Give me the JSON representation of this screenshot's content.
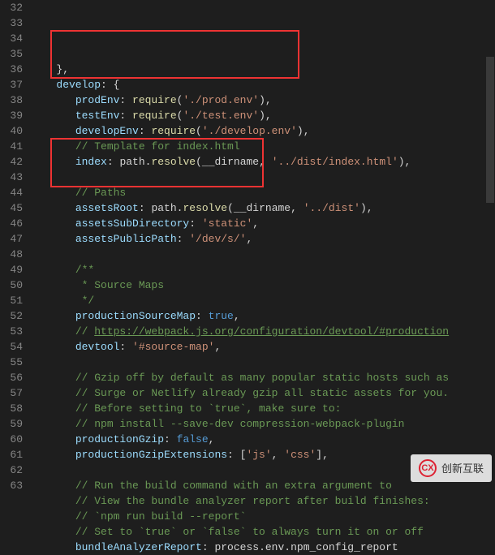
{
  "line_start": 32,
  "lines": [
    {
      "indent": 1,
      "tokens": [
        [
          "punc",
          "},"
        ]
      ]
    },
    {
      "indent": 1,
      "tokens": [
        [
          "prop",
          "develop"
        ],
        [
          "punc",
          ": {"
        ]
      ]
    },
    {
      "indent": 2,
      "tokens": [
        [
          "prop",
          "prodEnv"
        ],
        [
          "punc",
          ": "
        ],
        [
          "func",
          "require"
        ],
        [
          "punc",
          "("
        ],
        [
          "str",
          "'./prod.env'"
        ],
        [
          "punc",
          "),"
        ]
      ]
    },
    {
      "indent": 2,
      "tokens": [
        [
          "prop",
          "testEnv"
        ],
        [
          "punc",
          ": "
        ],
        [
          "func",
          "require"
        ],
        [
          "punc",
          "("
        ],
        [
          "str",
          "'./test.env'"
        ],
        [
          "punc",
          "),"
        ]
      ]
    },
    {
      "indent": 2,
      "tokens": [
        [
          "prop",
          "developEnv"
        ],
        [
          "punc",
          ": "
        ],
        [
          "func",
          "require"
        ],
        [
          "punc",
          "("
        ],
        [
          "str",
          "'./develop.env'"
        ],
        [
          "punc",
          "),"
        ]
      ]
    },
    {
      "indent": 2,
      "tokens": [
        [
          "com",
          "// Template for index.html"
        ]
      ]
    },
    {
      "indent": 2,
      "tokens": [
        [
          "prop",
          "index"
        ],
        [
          "punc",
          ": "
        ],
        [
          "var",
          "path"
        ],
        [
          "punc",
          "."
        ],
        [
          "func",
          "resolve"
        ],
        [
          "punc",
          "("
        ],
        [
          "var",
          "__dirname"
        ],
        [
          "punc",
          ", "
        ],
        [
          "str",
          "'../dist/index.html'"
        ],
        [
          "punc",
          "),"
        ]
      ]
    },
    {
      "indent": 0,
      "tokens": []
    },
    {
      "indent": 2,
      "tokens": [
        [
          "com",
          "// Paths"
        ]
      ]
    },
    {
      "indent": 2,
      "tokens": [
        [
          "prop",
          "assetsRoot"
        ],
        [
          "punc",
          ": "
        ],
        [
          "var",
          "path"
        ],
        [
          "punc",
          "."
        ],
        [
          "func",
          "resolve"
        ],
        [
          "punc",
          "("
        ],
        [
          "var",
          "__dirname"
        ],
        [
          "punc",
          ", "
        ],
        [
          "str",
          "'../dist'"
        ],
        [
          "punc",
          "),"
        ]
      ]
    },
    {
      "indent": 2,
      "tokens": [
        [
          "prop",
          "assetsSubDirectory"
        ],
        [
          "punc",
          ": "
        ],
        [
          "str",
          "'static'"
        ],
        [
          "punc",
          ","
        ]
      ]
    },
    {
      "indent": 2,
      "tokens": [
        [
          "prop",
          "assetsPublicPath"
        ],
        [
          "punc",
          ": "
        ],
        [
          "str",
          "'/dev/s/'"
        ],
        [
          "punc",
          ","
        ]
      ]
    },
    {
      "indent": 0,
      "tokens": []
    },
    {
      "indent": 2,
      "tokens": [
        [
          "com",
          "/**"
        ]
      ]
    },
    {
      "indent": 2,
      "tokens": [
        [
          "com",
          " * Source Maps"
        ]
      ]
    },
    {
      "indent": 2,
      "tokens": [
        [
          "com",
          " */"
        ]
      ]
    },
    {
      "indent": 2,
      "tokens": [
        [
          "prop",
          "productionSourceMap"
        ],
        [
          "punc",
          ": "
        ],
        [
          "bool",
          "true"
        ],
        [
          "punc",
          ","
        ]
      ]
    },
    {
      "indent": 2,
      "tokens": [
        [
          "com",
          "// "
        ],
        [
          "link",
          "https://webpack.js.org/configuration/devtool/#production"
        ]
      ]
    },
    {
      "indent": 2,
      "tokens": [
        [
          "prop",
          "devtool"
        ],
        [
          "punc",
          ": "
        ],
        [
          "str",
          "'#source-map'"
        ],
        [
          "punc",
          ","
        ]
      ]
    },
    {
      "indent": 0,
      "tokens": []
    },
    {
      "indent": 2,
      "tokens": [
        [
          "com",
          "// Gzip off by default as many popular static hosts such as"
        ]
      ]
    },
    {
      "indent": 2,
      "tokens": [
        [
          "com",
          "// Surge or Netlify already gzip all static assets for you."
        ]
      ]
    },
    {
      "indent": 2,
      "tokens": [
        [
          "com",
          "// Before setting to `true`, make sure to:"
        ]
      ]
    },
    {
      "indent": 2,
      "tokens": [
        [
          "com",
          "// npm install --save-dev compression-webpack-plugin"
        ]
      ]
    },
    {
      "indent": 2,
      "tokens": [
        [
          "prop",
          "productionGzip"
        ],
        [
          "punc",
          ": "
        ],
        [
          "bool",
          "false"
        ],
        [
          "punc",
          ","
        ]
      ]
    },
    {
      "indent": 2,
      "tokens": [
        [
          "prop",
          "productionGzipExtensions"
        ],
        [
          "punc",
          ": ["
        ],
        [
          "str",
          "'js'"
        ],
        [
          "punc",
          ", "
        ],
        [
          "str",
          "'css'"
        ],
        [
          "punc",
          "],"
        ]
      ]
    },
    {
      "indent": 0,
      "tokens": []
    },
    {
      "indent": 2,
      "tokens": [
        [
          "com",
          "// Run the build command with an extra argument to"
        ]
      ]
    },
    {
      "indent": 2,
      "tokens": [
        [
          "com",
          "// View the bundle analyzer report after build finishes:"
        ]
      ]
    },
    {
      "indent": 2,
      "tokens": [
        [
          "com",
          "// `npm run build --report`"
        ]
      ]
    },
    {
      "indent": 2,
      "tokens": [
        [
          "com",
          "// Set to `true` or `false` to always turn it on or off"
        ]
      ]
    },
    {
      "indent": 2,
      "tokens": [
        [
          "prop",
          "bundleAnalyzerReport"
        ],
        [
          "punc",
          ": "
        ],
        [
          "var",
          "process"
        ],
        [
          "punc",
          "."
        ],
        [
          "var",
          "env"
        ],
        [
          "punc",
          "."
        ],
        [
          "var",
          "npm_config_report"
        ]
      ]
    }
  ],
  "watermark": "创新互联"
}
